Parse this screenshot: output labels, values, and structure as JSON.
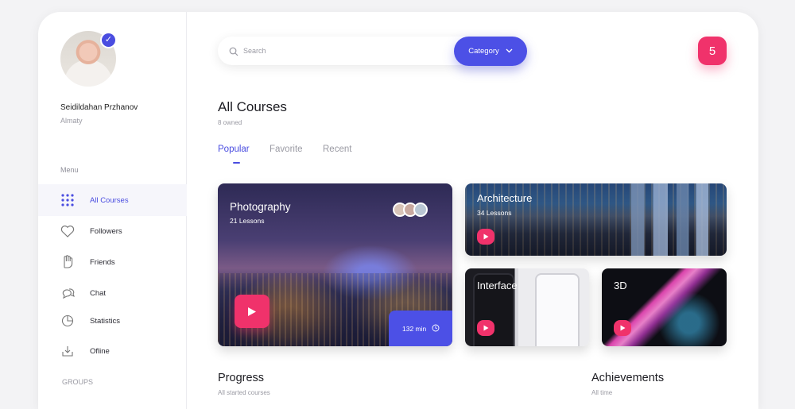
{
  "user": {
    "name": "Seidildahan Przhanov",
    "city": "Almaty"
  },
  "sidebar": {
    "menu_title": "Menu",
    "items": [
      {
        "label": "All Courses",
        "icon": "grid-icon",
        "active": true
      },
      {
        "label": "Followers",
        "icon": "heart-icon",
        "active": false
      },
      {
        "label": "Friends",
        "icon": "hand-icon",
        "active": false
      },
      {
        "label": "Chat",
        "icon": "chat-icon",
        "active": false
      },
      {
        "label": "Statistics",
        "icon": "pie-chart-icon",
        "active": false
      },
      {
        "label": "Ofline",
        "icon": "download-icon",
        "active": false
      }
    ],
    "groups_title": "GROUPS"
  },
  "search": {
    "placeholder": "Search",
    "category_label": "Category"
  },
  "notifications": {
    "count": "5"
  },
  "page": {
    "title": "All Courses",
    "subtitle": "8 owned"
  },
  "tabs": [
    {
      "label": "Popular",
      "active": true
    },
    {
      "label": "Favorite",
      "active": false
    },
    {
      "label": "Recent",
      "active": false
    }
  ],
  "courses": [
    {
      "title": "Photography",
      "lessons": "21 Lessons",
      "duration": "132 min"
    },
    {
      "title": "Architecture",
      "lessons": "34 Lessons"
    },
    {
      "title": "Interface"
    },
    {
      "title": "3D"
    }
  ],
  "sections": {
    "progress_title": "Progress",
    "progress_sub": "All started courses",
    "achievements_title": "Achievements",
    "achievements_sub": "All time"
  },
  "colors": {
    "accent": "#4c50e6",
    "pink": "#f0326b",
    "text": "#1c1c22",
    "muted": "#9a9aa3"
  }
}
